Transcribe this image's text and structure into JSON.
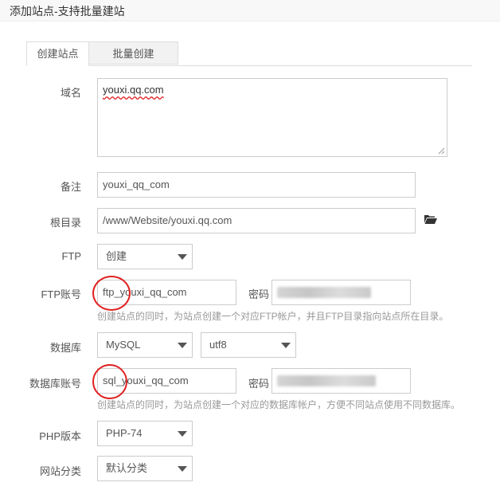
{
  "window": {
    "title": "添加站点-支持批量建站"
  },
  "tabs": [
    {
      "label": "创建站点",
      "active": true
    },
    {
      "label": "批量创建",
      "active": false
    }
  ],
  "form": {
    "domain": {
      "label": "域名",
      "value": "youxi.qq.com"
    },
    "remark": {
      "label": "备注",
      "value": "youxi_qq_com"
    },
    "root": {
      "label": "根目录",
      "value": "/www/Website/youxi.qq.com"
    },
    "ftp": {
      "label": "FTP",
      "value": "创建"
    },
    "ftp_account": {
      "label": "FTP账号",
      "value": "ftp_youxi_qq_com",
      "password_label": "密码",
      "hint": "创建站点的同时，为站点创建一个对应FTP帐户，并且FTP目录指向站点所在目录。"
    },
    "database": {
      "label": "数据库",
      "type": "MySQL",
      "charset": "utf8"
    },
    "db_account": {
      "label": "数据库账号",
      "value": "sql_youxi_qq_com",
      "password_label": "密码",
      "hint": "创建站点的同时，为站点创建一个对应的数据库帐户，方便不同站点使用不同数据库。"
    },
    "php": {
      "label": "PHP版本",
      "value": "PHP-74"
    },
    "category": {
      "label": "网站分类",
      "value": "默认分类"
    }
  },
  "colors": {
    "annotation_circle": "#e02020",
    "folder_icon": "#333333"
  }
}
